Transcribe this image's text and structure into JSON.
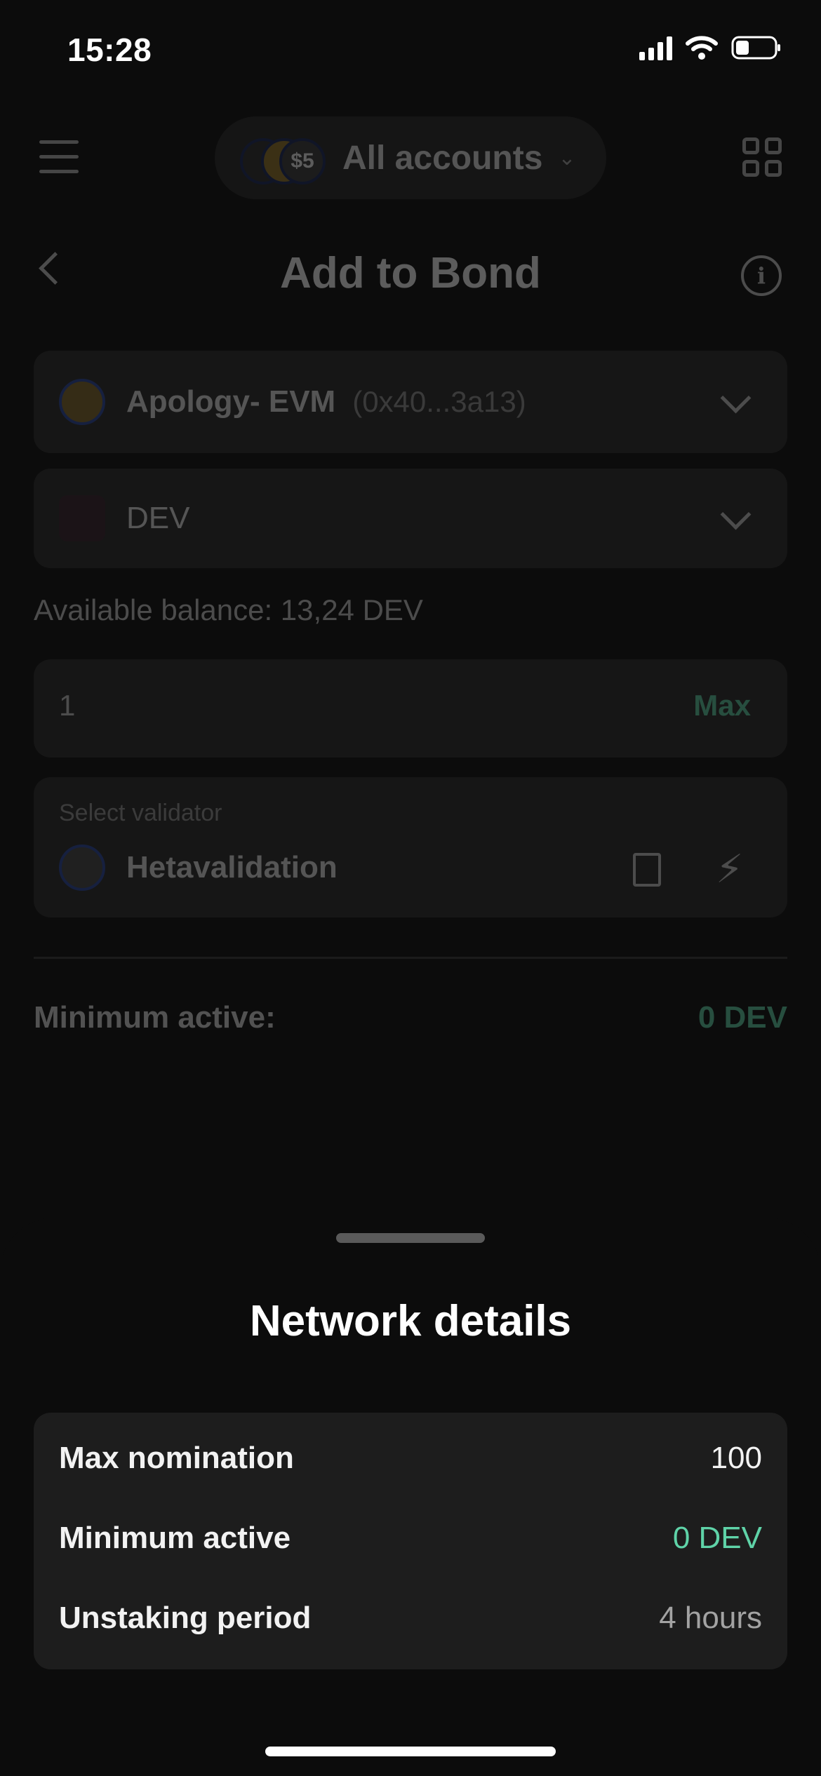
{
  "status_bar": {
    "time": "15:28"
  },
  "header": {
    "account_selector_label": "All accounts",
    "title": "Add to Bond"
  },
  "account": {
    "name": "Apology- EVM",
    "address": "(0x40...3a13)"
  },
  "token": {
    "symbol": "DEV"
  },
  "balance": {
    "text": "Available balance: 13,24 DEV"
  },
  "amount": {
    "value": "1",
    "max_label": "Max"
  },
  "validator": {
    "section_label": "Select validator",
    "name": "Hetavalidation"
  },
  "summary": {
    "minimum_active_label": "Minimum active:",
    "minimum_active_value": "0 DEV"
  },
  "sheet": {
    "title": "Network details",
    "rows": [
      {
        "label": "Max nomination",
        "value": "100"
      },
      {
        "label": "Minimum active",
        "value": "0 DEV"
      },
      {
        "label": "Unstaking period",
        "value": "4 hours"
      }
    ]
  },
  "colors": {
    "accent": "#5fd3a8",
    "background": "#0c0c0c",
    "card": "#1d1d1d"
  },
  "icons": [
    "menu-icon",
    "chevron-down-icon",
    "qr-code-icon",
    "back-arrow-icon",
    "info-icon",
    "book-icon",
    "lightning-icon",
    "signal-icon",
    "wifi-icon",
    "battery-icon"
  ]
}
